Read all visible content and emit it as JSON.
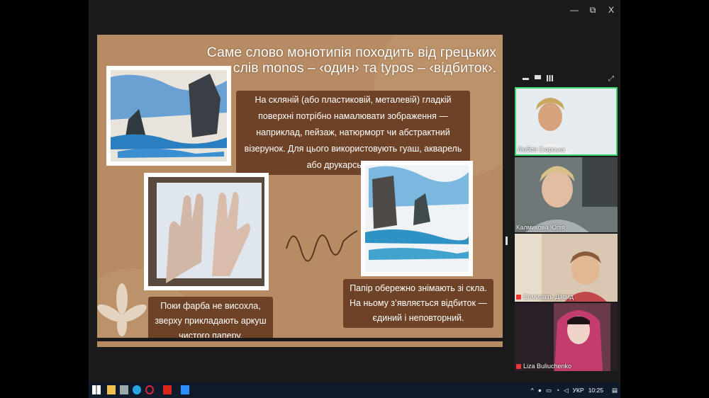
{
  "window": {
    "minimize": "—",
    "restore": "⧉",
    "close": "X"
  },
  "view_controls": {
    "layout_icon": "speaker-view-icon",
    "grid_icon": "grid-view-icon",
    "expand_icon": "expand-icon"
  },
  "slide": {
    "title": "Саме слово монотипія походить від грецьких слів monos – ‹один› та typos – ‹відбиток›.",
    "caption1": "На скляній (або пластиковій, металевій) гладкій поверхні потрібно намалювати зображення — наприклад, пейзаж, натюрморт чи абстрактний візерунок. Для цього використовують гуаш, акварель або друкарські фарби.",
    "caption2": "Поки фарба не висохла, зверху прикладають аркуш чистого паперу.",
    "caption3": "Папір обережно знімають зі скла. На ньому з’являється відбиток — єдиний і неповторний."
  },
  "participants": [
    {
      "name": "Любов Сюрська",
      "muted": false
    },
    {
      "name": "Калмикова Юлія",
      "muted": false
    },
    {
      "name": "Семиразъ Давид",
      "muted": true
    },
    {
      "name": "Liza Buliuchenko",
      "muted": true
    }
  ],
  "taskbar": {
    "lang": "УКР",
    "time": "10:25"
  }
}
